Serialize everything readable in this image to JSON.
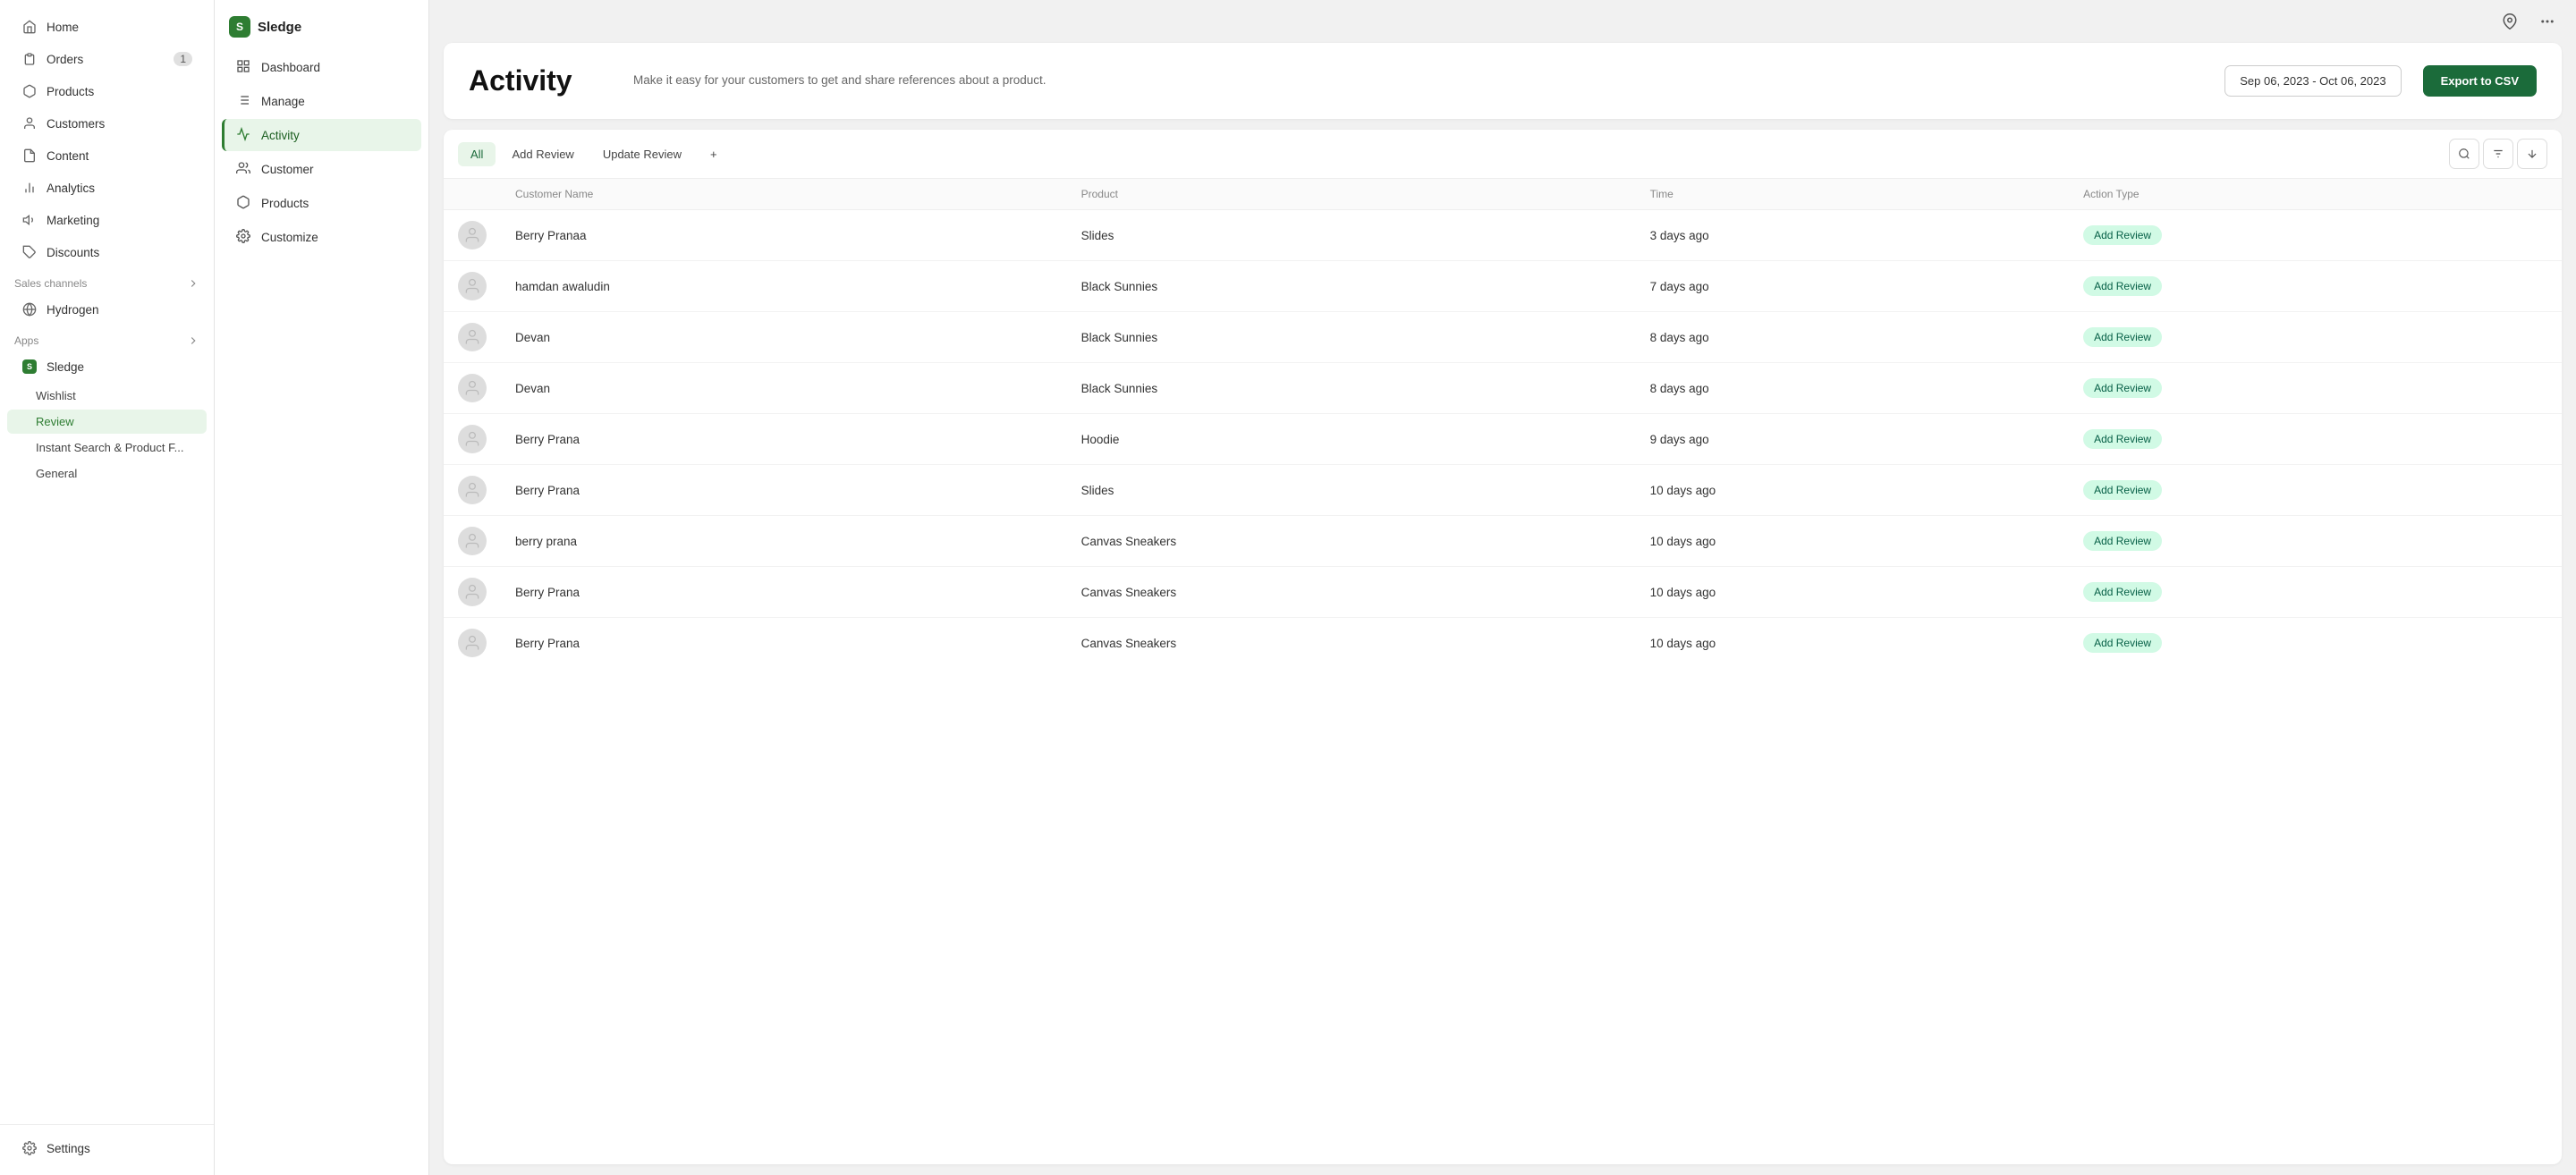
{
  "app": {
    "name": "Sledge"
  },
  "topbar": {
    "pin_icon": "📌",
    "more_icon": "•••"
  },
  "left_sidebar": {
    "items": [
      {
        "id": "home",
        "label": "Home",
        "icon": "home"
      },
      {
        "id": "orders",
        "label": "Orders",
        "icon": "orders",
        "badge": "1"
      },
      {
        "id": "products",
        "label": "Products",
        "icon": "products"
      },
      {
        "id": "customers",
        "label": "Customers",
        "icon": "customers"
      },
      {
        "id": "content",
        "label": "Content",
        "icon": "content"
      },
      {
        "id": "analytics",
        "label": "Analytics",
        "icon": "analytics"
      },
      {
        "id": "marketing",
        "label": "Marketing",
        "icon": "marketing"
      },
      {
        "id": "discounts",
        "label": "Discounts",
        "icon": "discounts"
      }
    ],
    "sales_channels": {
      "title": "Sales channels",
      "items": [
        {
          "id": "hydrogen",
          "label": "Hydrogen",
          "icon": "hydrogen"
        }
      ]
    },
    "apps": {
      "title": "Apps",
      "items": [
        {
          "id": "sledge",
          "label": "Sledge",
          "icon": "sledge"
        },
        {
          "id": "wishlist",
          "label": "Wishlist"
        },
        {
          "id": "review",
          "label": "Review",
          "active": true
        },
        {
          "id": "instant-search",
          "label": "Instant Search & Product F..."
        },
        {
          "id": "general",
          "label": "General"
        }
      ]
    },
    "settings": {
      "label": "Settings",
      "icon": "settings"
    }
  },
  "sub_sidebar": {
    "title": "Sledge",
    "items": [
      {
        "id": "dashboard",
        "label": "Dashboard",
        "icon": "dashboard"
      },
      {
        "id": "manage",
        "label": "Manage",
        "icon": "manage"
      },
      {
        "id": "activity",
        "label": "Activity",
        "icon": "activity",
        "active": true
      },
      {
        "id": "customer",
        "label": "Customer",
        "icon": "customer"
      },
      {
        "id": "products",
        "label": "Products",
        "icon": "products"
      },
      {
        "id": "customize",
        "label": "Customize",
        "icon": "customize"
      }
    ]
  },
  "activity_header": {
    "title": "Activity",
    "description": "Make it easy for your customers to get and share references about a product.",
    "date_range": "Sep 06, 2023 - Oct 06, 2023",
    "export_label": "Export to CSV"
  },
  "filter_tabs": [
    {
      "id": "all",
      "label": "All",
      "active": true
    },
    {
      "id": "add-review",
      "label": "Add Review"
    },
    {
      "id": "update-review",
      "label": "Update Review"
    },
    {
      "id": "plus",
      "label": "+"
    }
  ],
  "table": {
    "columns": [
      {
        "id": "customer-name",
        "label": "Customer Name"
      },
      {
        "id": "product",
        "label": "Product"
      },
      {
        "id": "time",
        "label": "Time"
      },
      {
        "id": "action-type",
        "label": "Action Type"
      }
    ],
    "rows": [
      {
        "id": 1,
        "customer": "Berry Pranaa",
        "product": "Slides",
        "time": "3 days ago",
        "action": "Add Review"
      },
      {
        "id": 2,
        "customer": "hamdan awaludin",
        "product": "Black Sunnies",
        "time": "7 days ago",
        "action": "Add Review"
      },
      {
        "id": 3,
        "customer": "Devan",
        "product": "Black Sunnies",
        "time": "8 days ago",
        "action": "Add Review"
      },
      {
        "id": 4,
        "customer": "Devan",
        "product": "Black Sunnies",
        "time": "8 days ago",
        "action": "Add Review"
      },
      {
        "id": 5,
        "customer": "Berry Prana",
        "product": "Hoodie",
        "time": "9 days ago",
        "action": "Add Review"
      },
      {
        "id": 6,
        "customer": "Berry Prana",
        "product": "Slides",
        "time": "10 days ago",
        "action": "Add Review"
      },
      {
        "id": 7,
        "customer": "berry prana",
        "product": "Canvas Sneakers",
        "time": "10 days ago",
        "action": "Add Review"
      },
      {
        "id": 8,
        "customer": "Berry Prana",
        "product": "Canvas Sneakers",
        "time": "10 days ago",
        "action": "Add Review"
      },
      {
        "id": 9,
        "customer": "Berry Prana",
        "product": "Canvas Sneakers",
        "time": "10 days ago",
        "action": "Add Review"
      }
    ]
  }
}
